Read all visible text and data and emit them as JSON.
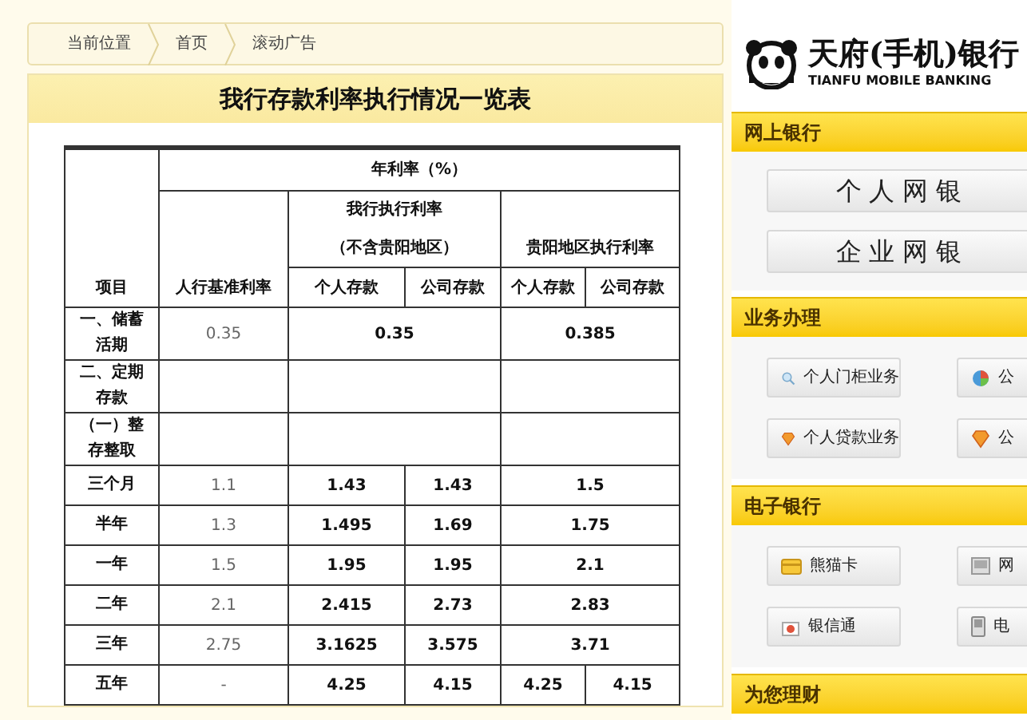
{
  "breadcrumb": [
    "当前位置",
    "首页",
    "滚动广告"
  ],
  "title": "我行存款利率执行情况一览表",
  "table": {
    "head": {
      "item": "项目",
      "annual": "年利率（%）",
      "base": "人行基准利率",
      "own": "我行执行利率",
      "own_note": "（不含贵阳地区）",
      "guiyang": "贵阳地区执行利率",
      "personal": "个人存款",
      "company": "公司存款",
      "personal_2": "个人存款",
      "company_2": "公司存款"
    },
    "rows": [
      {
        "label": "一、储蓄活期",
        "base": "0.35",
        "own": [
          "0.35"
        ],
        "guiyang": [
          "0.385"
        ]
      },
      {
        "label": "二、定期存款"
      },
      {
        "label": "（一）整存整取"
      },
      {
        "label": "三个月",
        "base": "1.1",
        "own": [
          "1.43",
          "1.43"
        ],
        "guiyang": [
          "1.5"
        ]
      },
      {
        "label": "半年",
        "base": "1.3",
        "own": [
          "1.495",
          "1.69"
        ],
        "guiyang": [
          "1.75"
        ]
      },
      {
        "label": "一年",
        "base": "1.5",
        "own": [
          "1.95",
          "1.95"
        ],
        "guiyang": [
          "2.1"
        ]
      },
      {
        "label": "二年",
        "base": "2.1",
        "own": [
          "2.415",
          "2.73"
        ],
        "guiyang": [
          "2.83"
        ]
      },
      {
        "label": "三年",
        "base": "2.75",
        "own": [
          "3.1625",
          "3.575"
        ],
        "guiyang": [
          "3.71"
        ]
      },
      {
        "label": "五年",
        "base": "-",
        "own": [
          "4.25",
          "4.15"
        ],
        "guiyang": [
          "4.25",
          "4.15"
        ]
      }
    ]
  },
  "sidebar": {
    "logo": {
      "name": "天府(手机)银行",
      "subtitle": "TIANFU MOBILE BANKING"
    },
    "sections": [
      {
        "title": "网上银行",
        "kind": "big",
        "buttons": [
          "个人网银",
          "企业网银"
        ]
      },
      {
        "title": "业务办理",
        "kind": "small",
        "buttons": [
          "个人门柜业务",
          "公",
          "个人贷款业务",
          "公"
        ]
      },
      {
        "title": "电子银行",
        "kind": "small",
        "buttons": [
          "熊猫卡",
          "网",
          "银信通",
          "电"
        ]
      },
      {
        "title": "为您理财",
        "kind": "header"
      }
    ]
  }
}
